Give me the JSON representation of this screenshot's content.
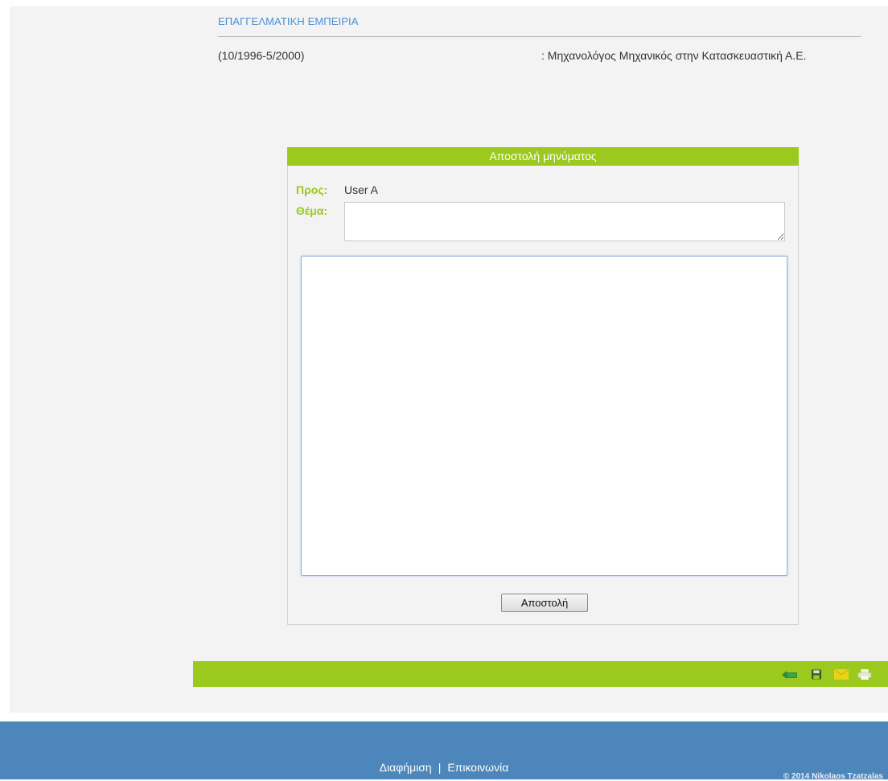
{
  "experience": {
    "title": "ΕΠΑΓΓΕΛΜΑΤΙΚΗ ΕΜΠΕΙΡΙΑ",
    "period": "(10/1996-5/2000)",
    "description": ": Μηχανολόγος Μηχανικός στην Κατασκευαστική Α.Ε."
  },
  "message_form": {
    "header": "Αποστολή μηνύματος",
    "to_label": "Προς:",
    "to_value": "User A",
    "subject_label": "Θέμα:",
    "subject_value": "",
    "body_value": "",
    "send_label": "Αποστολή"
  },
  "toolbar": {
    "icons": [
      "back-icon",
      "save-icon",
      "mail-icon",
      "print-icon"
    ]
  },
  "footer": {
    "link_advertising": "Διαφήμιση",
    "separator": "|",
    "link_contact": "Επικοινωνία",
    "copyright": "© 2014 Nikolaos Tzatzalas"
  },
  "colors": {
    "accent_green": "#9bc91d",
    "footer_blue": "#4d86ba",
    "link_blue": "#4a8fd4",
    "panel_bg": "#f3f3f3"
  }
}
